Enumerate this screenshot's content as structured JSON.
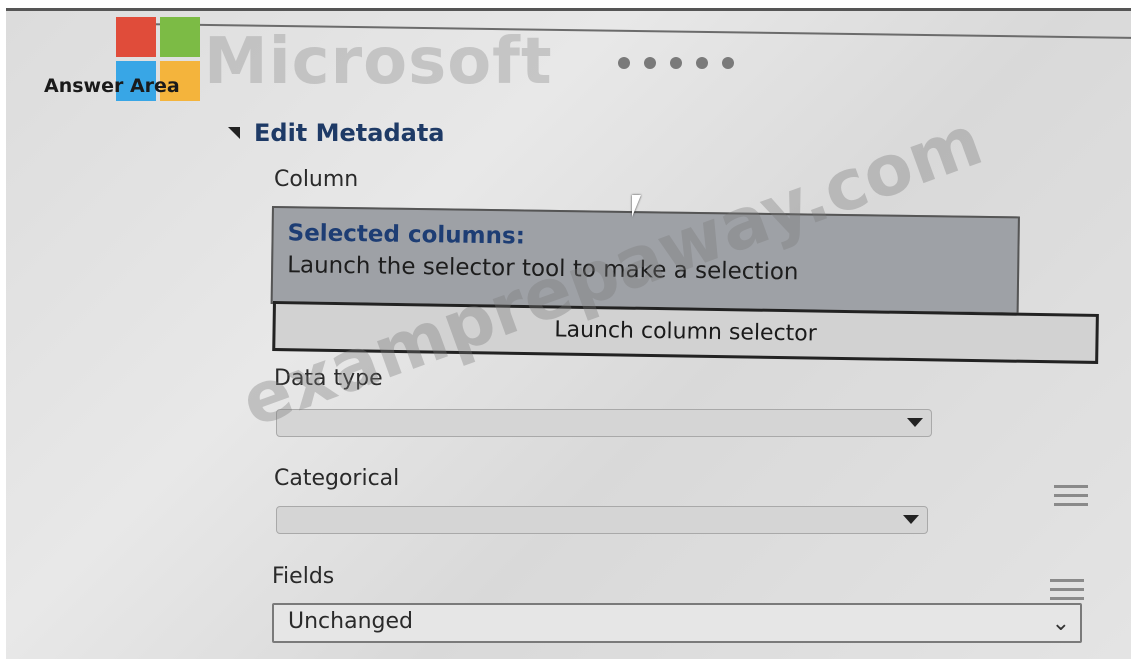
{
  "header": {
    "answer_area_label": "Answer Area",
    "brand": "Microsoft",
    "brand_colors": [
      "#e04c3a",
      "#7cbb45",
      "#38a6e6",
      "#f4b43c"
    ]
  },
  "edit_metadata": {
    "section_title": "Edit Metadata",
    "column_label": "Column",
    "selected_columns_title": "Selected columns:",
    "selected_columns_text": "Launch the selector tool to make a selection",
    "launch_button_label": "Launch column selector",
    "data_type_label": "Data type",
    "data_type_value": "",
    "categorical_label": "Categorical",
    "categorical_value": "",
    "fields_label": "Fields",
    "fields_value": "Unchanged"
  },
  "watermark": "examprepaway.com"
}
